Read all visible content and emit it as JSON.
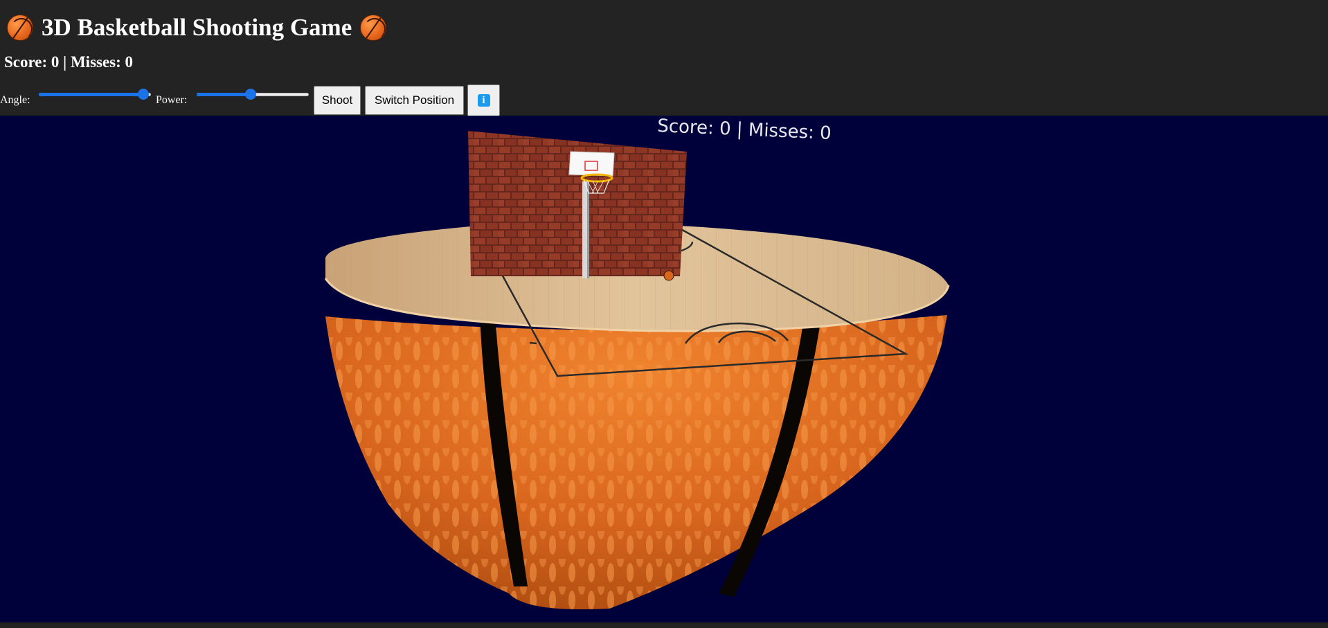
{
  "header": {
    "title": "3D Basketball Shooting Game",
    "title_icon": "basketball-icon",
    "score_line": "Score: 0 | Misses: 0"
  },
  "controls": {
    "angle_label": "Angle:",
    "angle_value": 0.93,
    "power_label": "Power:",
    "power_value": 0.48,
    "shoot_label": "Shoot",
    "switch_label": "Switch Position",
    "info_icon": "info-icon",
    "accent_color": "#1a73e8"
  },
  "scene": {
    "hud_score": "Score: 0 | Misses: 0",
    "background_color": "#00003a",
    "wall": "brick",
    "court": "wooden-floor",
    "base": "half-basketball"
  }
}
